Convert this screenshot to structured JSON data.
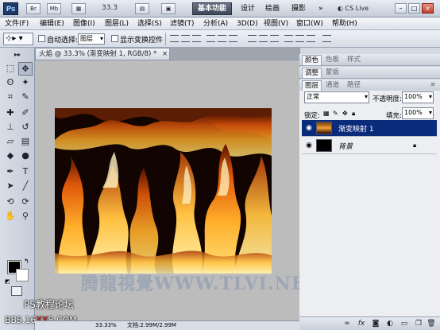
{
  "appbar": {
    "logo": "Ps",
    "br_label": "Br",
    "mb_label": "Mb",
    "zoom": "33.3",
    "workspaces": [
      "基本功能",
      "设计",
      "绘画",
      "摄影"
    ],
    "more": "»",
    "cs_live": "CS Live",
    "window_controls": [
      "minimize-icon",
      "maximize-icon",
      "close-icon"
    ]
  },
  "menu": [
    "文件(F)",
    "编辑(E)",
    "图像(I)",
    "图层(L)",
    "选择(S)",
    "滤镜(T)",
    "分析(A)",
    "3D(D)",
    "视图(V)",
    "窗口(W)",
    "帮助(H)"
  ],
  "options": {
    "auto_select_label": "自动选择:",
    "auto_select_value": "图层",
    "show_transform_label": "显示变换控件"
  },
  "document": {
    "tab_title": "火焰 @ 33.3% (渐变映射 1, RGB/8) *",
    "tab_close": "×",
    "status_text": "33.33%",
    "status_doc": "文档:2.99M/2.99M"
  },
  "watermark": "腾龍視覺WWW.TLVI.NET",
  "forum": {
    "line1": "PS教程论坛",
    "line2_a": "BBS.16",
    "line2_red": "XX",
    "line2_b": "8.COM"
  },
  "panels": {
    "group1_tabs": [
      "颜色",
      "色板",
      "样式"
    ],
    "group2_tabs": [
      "调整",
      "蒙版"
    ],
    "group3_tabs": [
      "图层",
      "通道",
      "路径"
    ],
    "blend_mode": "正常",
    "opacity_label": "不透明度:",
    "opacity_value": "100%",
    "lock_label": "锁定:",
    "fill_label": "填充:",
    "fill_value": "100%",
    "layers": [
      {
        "name": "渐变映射 1",
        "selected": true
      },
      {
        "name": "背景",
        "selected": false
      }
    ]
  },
  "colors": {
    "accent": "#0a2a7a",
    "foreground": "#000000",
    "background": "#ffffff"
  }
}
